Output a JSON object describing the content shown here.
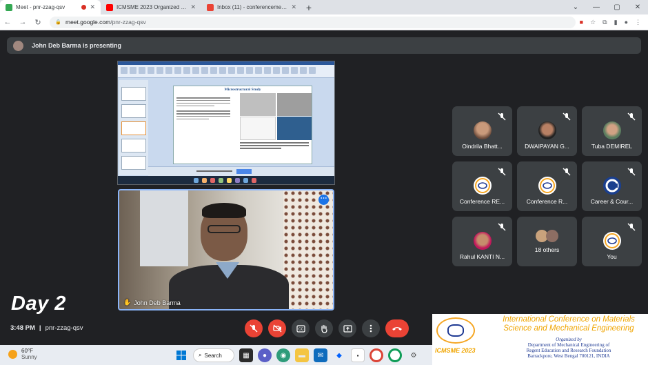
{
  "browser": {
    "tabs": [
      {
        "title": "Meet - pnr-zzag-qsv",
        "active": true
      },
      {
        "title": "ICMSME 2023 Organized by Dep"
      },
      {
        "title": "Inbox (11) - conferenceme@rege"
      }
    ],
    "url_host": "meet.google.com",
    "url_path": "/pnr-zzag-qsv"
  },
  "presenting_banner": "John Deb Barma is presenting",
  "presentation": {
    "slide_title": "Microstructural Study"
  },
  "presenter_tile": {
    "name": "John Deb Barma"
  },
  "participants": [
    {
      "name": "Oindrila Bhatt..."
    },
    {
      "name": "DWAIPAYAN G..."
    },
    {
      "name": "Tuba DEMIREL"
    },
    {
      "name": "Conference RE..."
    },
    {
      "name": "Conference R..."
    },
    {
      "name": "Career & Cour..."
    },
    {
      "name": "Rahul KANTI N..."
    },
    {
      "name": "18 others"
    },
    {
      "name": "You"
    }
  ],
  "overlay": {
    "day_label": "Day 2"
  },
  "meeting_info": {
    "time": "3:48 PM",
    "separator": "|",
    "code": "pnr-zzag-qsv"
  },
  "conference_banner": {
    "logo_label": "ICMSME 2023",
    "title_line1": "International Conference on Materials",
    "title_line2": "Science and Mechanical Engineering",
    "organized_by": "Organized by",
    "org_line1": "Department of Mechanical Engineering of",
    "org_line2": "Regent Education and Research Foundation",
    "org_line3": "Barrackpore, West Bengal 700121, INDIA"
  },
  "taskbar": {
    "temperature": "60°F",
    "condition": "Sunny",
    "search_label": "Search"
  },
  "colors": {
    "meet_bg": "#202124",
    "tile_bg": "#3c4043",
    "end_call": "#ea4335",
    "active_speaker": "#8ab4f8",
    "banner_orange": "#f0a500",
    "banner_blue": "#1f3a93"
  }
}
